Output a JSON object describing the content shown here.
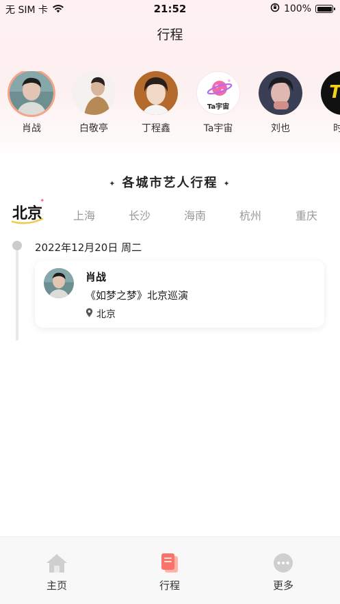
{
  "status_bar": {
    "carrier": "无 SIM 卡",
    "time": "21:52",
    "battery": "100%",
    "battery_level": 1.0
  },
  "nav": {
    "title": "行程"
  },
  "artists": [
    {
      "name": "肖战",
      "selected": true
    },
    {
      "name": "白敬亭",
      "selected": false
    },
    {
      "name": "丁程鑫",
      "selected": false
    },
    {
      "name": "Ta宇宙",
      "selected": false,
      "avatar_text": "Ta宇宙"
    },
    {
      "name": "刘也",
      "selected": false
    },
    {
      "name": "时代",
      "selected": false,
      "avatar_text": "TN"
    }
  ],
  "section": {
    "title": "各城市艺人行程"
  },
  "cities": {
    "active": "北京",
    "items": [
      "北京",
      "上海",
      "长沙",
      "海南",
      "杭州",
      "重庆"
    ]
  },
  "schedule": [
    {
      "date": "2022年12月20日 周二",
      "artist": "肖战",
      "title": "《如梦之梦》北京巡演",
      "location": "北京"
    }
  ],
  "tab_bar": {
    "items": [
      {
        "label": "主页",
        "icon": "home-icon"
      },
      {
        "label": "行程",
        "icon": "schedule-icon",
        "active": true
      },
      {
        "label": "更多",
        "icon": "more-icon"
      }
    ]
  },
  "colors": {
    "accent": "#f6a487",
    "tab_active_gradient": [
      "#ff9a8b",
      "#f96b6b"
    ],
    "muted": "#999999"
  }
}
